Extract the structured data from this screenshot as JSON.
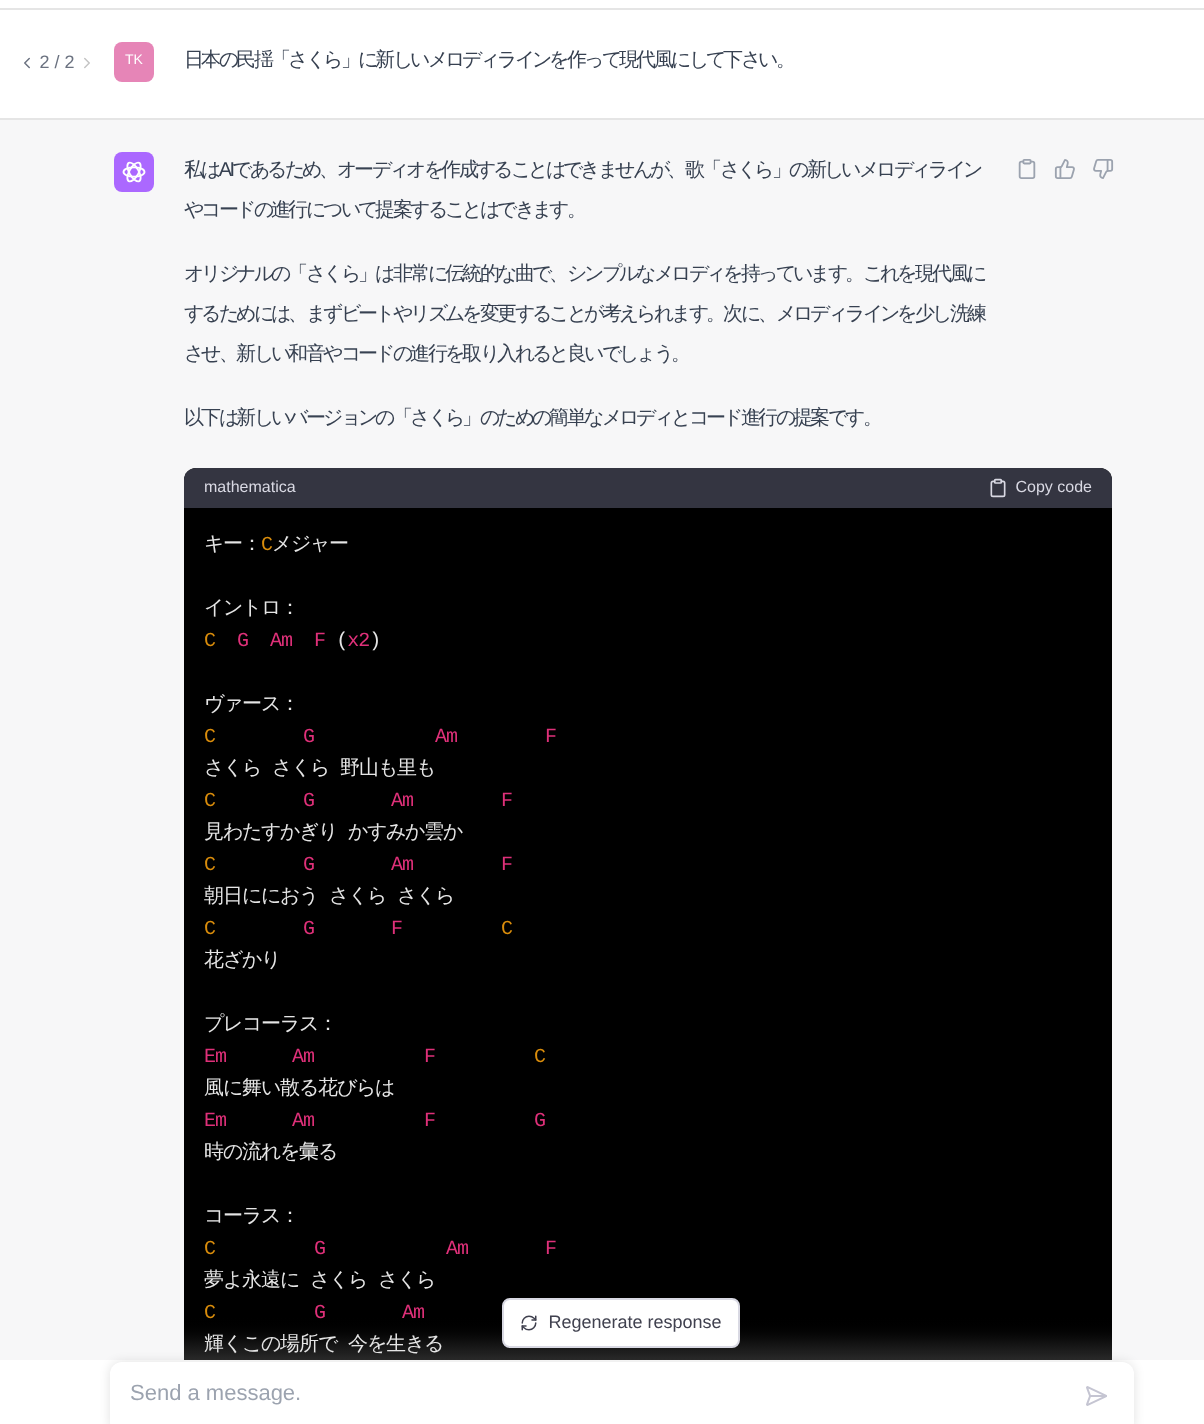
{
  "user_message": {
    "pager": "2 / 2",
    "avatar": "TK",
    "text": "日本の民揺「さくら」に新しいメロディラインを作って現代風にして下さい。"
  },
  "assistant_message": {
    "paragraphs": [
      "私はAIであるため、オーディオを作成することはできませんが、歌「さくら」の新しいメロディラインやコードの進行について提案することはできます。",
      "オリジナルの「さくら」は非常に伝統的な曲で、シンプルなメロディを持っています。これを現代風にするためには、まずビートやリズムを変更することが考えられます。次に、メロディラインを少し洗練させ、新しい和音やコードの進行を取り入れると良いでしょう。",
      "以下は新しいバージョンの「さくら」のための簡単なメロディとコード進行の提案です。"
    ],
    "code_block": {
      "language": "mathematica",
      "copy_label": "Copy code",
      "lines": [
        {
          "kind": "code",
          "segments": [
            {
              "text": "キー：",
              "color": "#e5e5e5"
            },
            {
              "text": "C",
              "color": "#d98c0b"
            },
            {
              "text": "メジャー",
              "color": "#e5e5e5"
            }
          ]
        },
        {
          "kind": "blank"
        },
        {
          "kind": "code",
          "segments": [
            {
              "text": "イントロ：",
              "color": "#e5e5e5"
            }
          ]
        },
        {
          "kind": "code",
          "segments": [
            {
              "text": "C",
              "color": "#d98c0b"
            },
            {
              "text": "  G",
              "color": "#df3079"
            },
            {
              "text": "  Am",
              "color": "#df3079"
            },
            {
              "text": "  F",
              "color": "#df3079"
            },
            {
              "text": " (",
              "color": "#e5e5e5"
            },
            {
              "text": "x2",
              "color": "#df3079"
            },
            {
              "text": ")",
              "color": "#e5e5e5"
            }
          ]
        },
        {
          "kind": "blank"
        },
        {
          "kind": "code",
          "segments": [
            {
              "text": "ヴァース：",
              "color": "#e5e5e5"
            }
          ]
        },
        {
          "kind": "code",
          "segments": [
            {
              "text": "C",
              "color": "#d98c0b"
            },
            {
              "text": "        G",
              "color": "#df3079"
            },
            {
              "text": "           Am",
              "color": "#df3079"
            },
            {
              "text": "        F",
              "color": "#df3079"
            }
          ]
        },
        {
          "kind": "code",
          "segments": [
            {
              "text": "さくら さくら 野山も里も",
              "color": "#e5e5e5"
            }
          ]
        },
        {
          "kind": "code",
          "segments": [
            {
              "text": "C",
              "color": "#d98c0b"
            },
            {
              "text": "        G",
              "color": "#df3079"
            },
            {
              "text": "       Am",
              "color": "#df3079"
            },
            {
              "text": "        F",
              "color": "#df3079"
            }
          ]
        },
        {
          "kind": "code",
          "segments": [
            {
              "text": "見わたすかぎり かすみか雲か",
              "color": "#e5e5e5"
            }
          ]
        },
        {
          "kind": "code",
          "segments": [
            {
              "text": "C",
              "color": "#d98c0b"
            },
            {
              "text": "        G",
              "color": "#df3079"
            },
            {
              "text": "       Am",
              "color": "#df3079"
            },
            {
              "text": "        F",
              "color": "#df3079"
            }
          ]
        },
        {
          "kind": "code",
          "segments": [
            {
              "text": "朝日ににおう さくら さくら",
              "color": "#e5e5e5"
            }
          ]
        },
        {
          "kind": "code",
          "segments": [
            {
              "text": "C",
              "color": "#d98c0b"
            },
            {
              "text": "        G",
              "color": "#df3079"
            },
            {
              "text": "       F",
              "color": "#df3079"
            },
            {
              "text": "         C",
              "color": "#d98c0b"
            }
          ]
        },
        {
          "kind": "code",
          "segments": [
            {
              "text": "花ざかり",
              "color": "#e5e5e5"
            }
          ]
        },
        {
          "kind": "blank"
        },
        {
          "kind": "code",
          "segments": [
            {
              "text": "プレコーラス：",
              "color": "#e5e5e5"
            }
          ]
        },
        {
          "kind": "code",
          "segments": [
            {
              "text": "Em",
              "color": "#df3079"
            },
            {
              "text": "      Am",
              "color": "#df3079"
            },
            {
              "text": "          F",
              "color": "#df3079"
            },
            {
              "text": "         C",
              "color": "#d98c0b"
            }
          ]
        },
        {
          "kind": "code",
          "segments": [
            {
              "text": "風に舞い散る花びらは",
              "color": "#e5e5e5"
            }
          ]
        },
        {
          "kind": "code",
          "segments": [
            {
              "text": "Em",
              "color": "#df3079"
            },
            {
              "text": "      Am",
              "color": "#df3079"
            },
            {
              "text": "          F",
              "color": "#df3079"
            },
            {
              "text": "         G",
              "color": "#df3079"
            }
          ]
        },
        {
          "kind": "code",
          "segments": [
            {
              "text": "時の流れを彙る",
              "color": "#e5e5e5"
            }
          ]
        },
        {
          "kind": "blank"
        },
        {
          "kind": "code",
          "segments": [
            {
              "text": "コーラス：",
              "color": "#e5e5e5"
            }
          ]
        },
        {
          "kind": "code",
          "segments": [
            {
              "text": "C",
              "color": "#d98c0b"
            },
            {
              "text": "         G",
              "color": "#df3079"
            },
            {
              "text": "           Am",
              "color": "#df3079"
            },
            {
              "text": "       F",
              "color": "#df3079"
            }
          ]
        },
        {
          "kind": "code",
          "segments": [
            {
              "text": "夢よ永遠に さくら さくら",
              "color": "#e5e5e5"
            }
          ]
        },
        {
          "kind": "code",
          "segments": [
            {
              "text": "C",
              "color": "#d98c0b"
            },
            {
              "text": "         G",
              "color": "#df3079"
            },
            {
              "text": "       Am",
              "color": "#df3079"
            }
          ]
        },
        {
          "kind": "code",
          "segments": [
            {
              "text": "輝くこの場所で 今を生きる",
              "color": "#e5e5e5"
            }
          ]
        }
      ]
    }
  },
  "regenerate_button": "Regenerate response",
  "composer": {
    "placeholder": "Send a message."
  }
}
